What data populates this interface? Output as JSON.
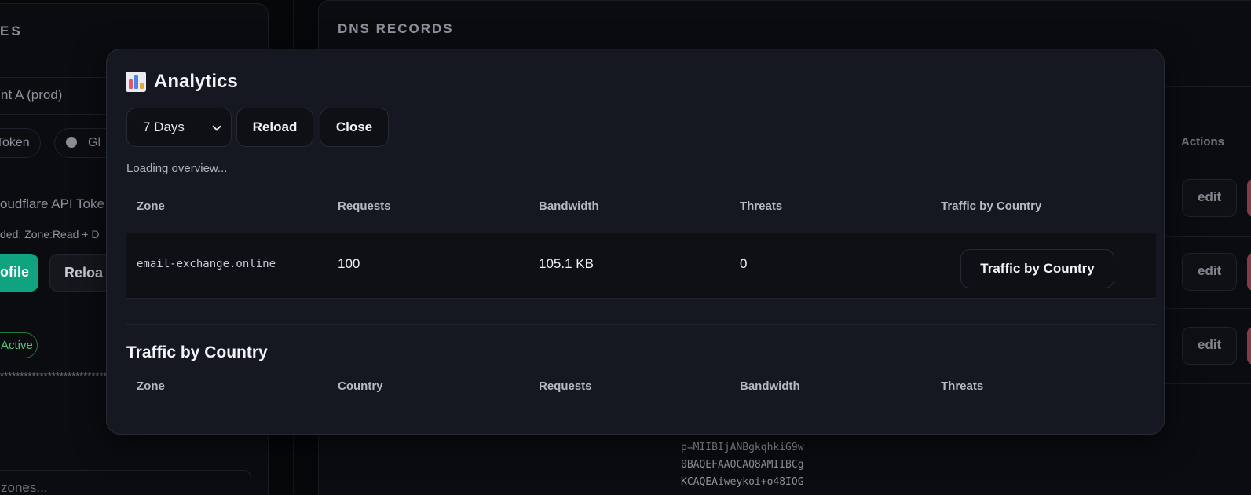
{
  "background": {
    "left_panel": {
      "title": "ES",
      "profile_input": "nt A (prod)",
      "pill_token": "Token",
      "pill_global": "Gl",
      "token_label": "oudflare API Toke",
      "token_hint": "ded: Zone:Read + D",
      "profile_button": "ofile",
      "reload_button": "Reloa",
      "status_badge": "Active",
      "masked_value": "****************************",
      "zones_input_placeholder": "zones..."
    },
    "right_panel": {
      "title": "DNS RECORDS",
      "actions_header": "Actions",
      "edit_label": "edit",
      "dkim_lines": [
        "p=MIIBIjANBgkqhkiG9w",
        "0BAQEFAAOCAQ8AMIIBCg",
        "KCAQEAiweykoi+o48IOG"
      ]
    }
  },
  "modal": {
    "title": "Analytics",
    "icon": "bar-chart-icon",
    "range_select": {
      "value": "7 Days"
    },
    "reload_label": "Reload",
    "close_label": "Close",
    "status_text": "Loading overview...",
    "overview_table": {
      "headers": [
        "Zone",
        "Requests",
        "Bandwidth",
        "Threats",
        "Traffic by Country"
      ],
      "rows": [
        {
          "zone": "email-exchange.online",
          "requests": "100",
          "bandwidth": "105.1 KB",
          "threats": "0",
          "action_label": "Traffic by Country"
        }
      ]
    },
    "country_section": {
      "title": "Traffic by Country",
      "headers": [
        "Zone",
        "Country",
        "Requests",
        "Bandwidth",
        "Threats"
      ]
    }
  },
  "colors": {
    "modal_bg": "#151820",
    "accent_green": "#0fa37f",
    "danger": "#8a3a45"
  }
}
